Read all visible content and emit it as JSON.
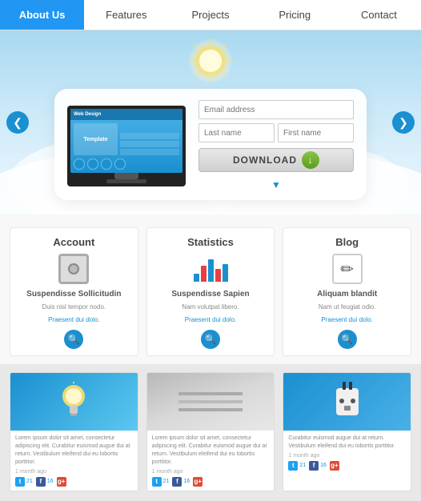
{
  "nav": {
    "items": [
      {
        "label": "About Us",
        "active": true
      },
      {
        "label": "Features",
        "active": false
      },
      {
        "label": "Projects",
        "active": false
      },
      {
        "label": "Pricing",
        "active": false
      },
      {
        "label": "Contact",
        "active": false
      }
    ]
  },
  "hero": {
    "email_placeholder": "Email address",
    "lastname_placeholder": "Last name",
    "firstname_placeholder": "First name",
    "download_label": "DOWNLOAD",
    "arrow_left": "❮",
    "arrow_right": "❯"
  },
  "features": {
    "cards": [
      {
        "title": "Account",
        "desc_name": "Suspendisse Sollicitudin",
        "desc_text": "Duis nisl tempor nodo.",
        "link": "Praesent dui dolo."
      },
      {
        "title": "Statistics",
        "desc_name": "Suspendisse Sapien",
        "desc_text": "Nam volutpat libero.",
        "link": "Praesent dui dolo."
      },
      {
        "title": "Blog",
        "desc_name": "Aliquam blandit",
        "desc_text": "Nam ut feugiat odio.",
        "link": "Praesent dui dolo."
      }
    ]
  },
  "posts": {
    "cards": [
      {
        "text": "Lorem ipsum dolor sit amet, consectetur adipiscing elit. Curabitur euismod augue dui at return. Vestibulum eleifend dui eu lobortis porttitor.",
        "date": "1 month ago",
        "tw": "21",
        "fb": "16",
        "gp": ""
      },
      {
        "text": "Lorem ipsum dolor sit amet, consectetur adipiscing elit. Curabitur euismod augue dui at return. Vestibulum eleifend dui eu lobortis porttitor.",
        "date": "1 month ago",
        "tw": "21",
        "fb": "16",
        "gp": ""
      },
      {
        "text": "Curabitur euismod augue dui at return. Vestibulum eleifend dui eu lobortis porttitor.",
        "date": "1 month ago",
        "tw": "21",
        "fb": "16",
        "gp": ""
      }
    ]
  }
}
